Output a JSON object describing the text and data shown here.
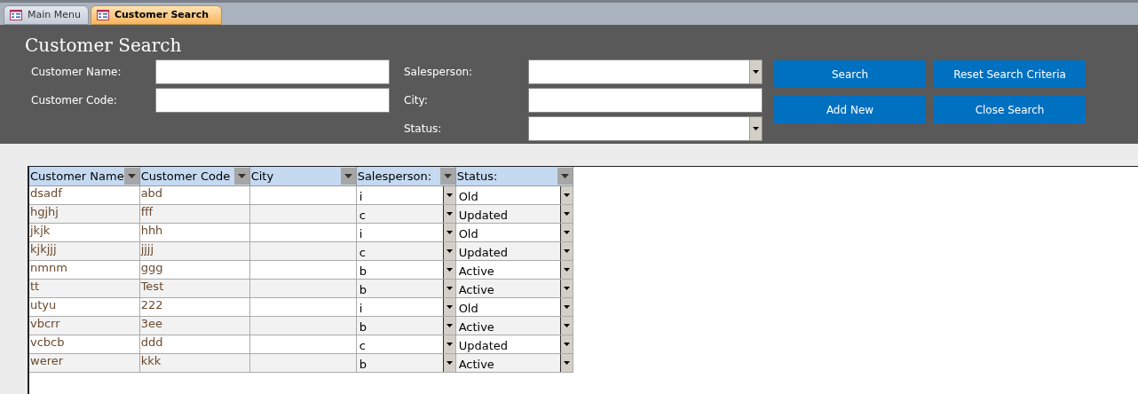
{
  "tabs": [
    {
      "label": "Main Menu",
      "selected": false
    },
    {
      "label": "Customer Search",
      "selected": true
    }
  ],
  "form": {
    "title": "Customer Search",
    "left_fields": [
      {
        "label": "Customer Name:",
        "kind": "text"
      },
      {
        "label": "Customer Code:",
        "kind": "text"
      }
    ],
    "right_fields": [
      {
        "label": "Salesperson:",
        "kind": "combo"
      },
      {
        "label": "City:",
        "kind": "text"
      },
      {
        "label": "Status:",
        "kind": "combo"
      }
    ],
    "buttons": [
      "Search",
      "Reset Search Criteria",
      "Add New",
      "Close Search"
    ]
  },
  "table": {
    "columns": [
      "Customer Name",
      "Customer Code",
      "City",
      "Salesperson:",
      "Status:"
    ],
    "rows": [
      [
        "dsadf",
        "abd",
        "",
        "i",
        "Old"
      ],
      [
        "hgjhj",
        "fff",
        "",
        "c",
        "Updated"
      ],
      [
        "jkjk",
        "hhh",
        "",
        "i",
        "Old"
      ],
      [
        "kjkjjj",
        "jjjj",
        "",
        "c",
        "Updated"
      ],
      [
        "nmnm",
        "ggg",
        "",
        "b",
        "Active"
      ],
      [
        "tt",
        "Test",
        "",
        "b",
        "Active"
      ],
      [
        "utyu",
        "222",
        "",
        "i",
        "Old"
      ],
      [
        "vbcrr",
        "3ee",
        "",
        "b",
        "Active"
      ],
      [
        "vcbcb",
        "ddd",
        "",
        "c",
        "Updated"
      ],
      [
        "werer",
        "kkk",
        "",
        "b",
        "Active"
      ]
    ]
  }
}
